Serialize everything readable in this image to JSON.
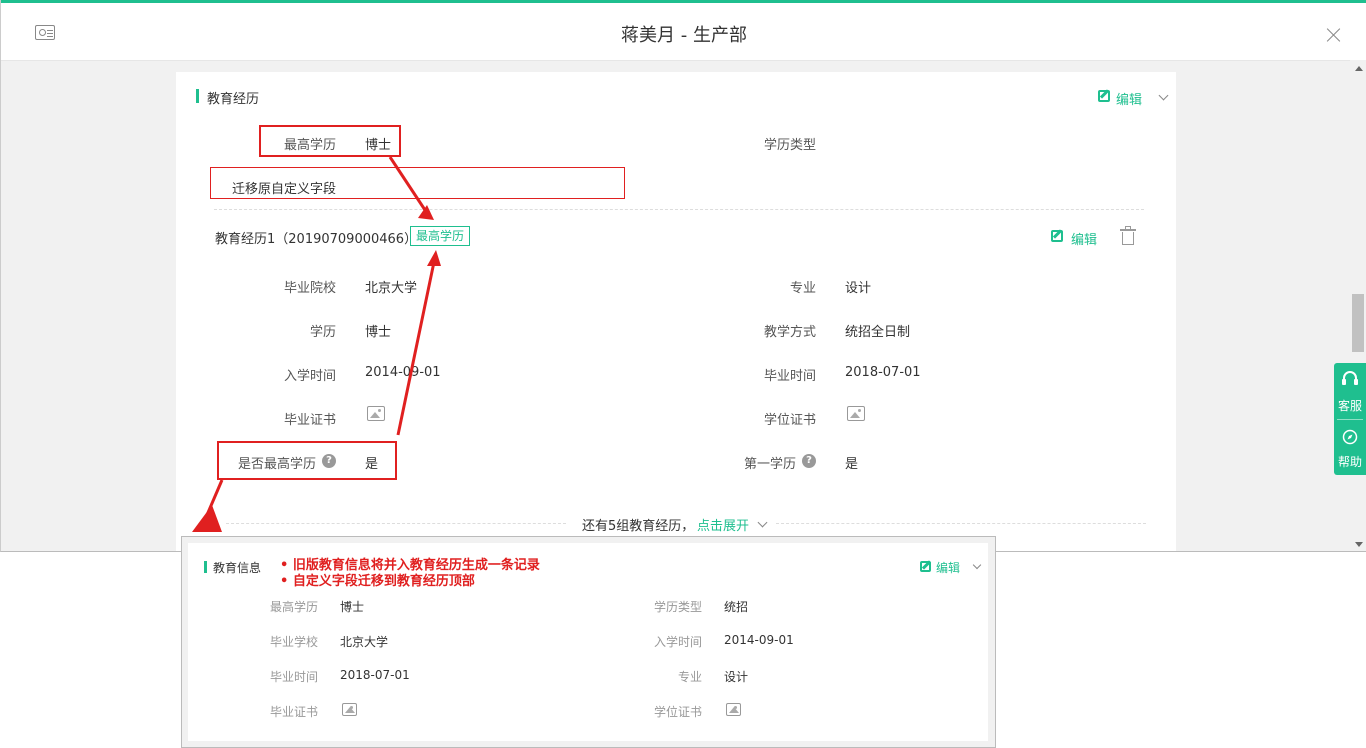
{
  "header": {
    "title": "蒋美月 - 生产部"
  },
  "education_section": {
    "title": "教育经历",
    "edit_label": "编辑",
    "top_fields": {
      "highest_degree_label": "最高学历",
      "highest_degree_value": "博士",
      "degree_type_label": "学历类型",
      "migrated_custom_field": "迁移原自定义字段"
    },
    "record": {
      "title": "教育经历1（20190709000466）",
      "tag": "最高学历",
      "edit_label": "编辑",
      "fields": {
        "school_label": "毕业院校",
        "school_value": "北京大学",
        "major_label": "专业",
        "major_value": "设计",
        "degree_label": "学历",
        "degree_value": "博士",
        "study_mode_label": "教学方式",
        "study_mode_value": "统招全日制",
        "enroll_label": "入学时间",
        "enroll_value": "2014-09-01",
        "grad_label": "毕业时间",
        "grad_value": "2018-07-01",
        "diploma_label": "毕业证书",
        "degree_cert_label": "学位证书",
        "is_highest_label": "是否最高学历",
        "is_highest_value": "是",
        "first_degree_label": "第一学历",
        "first_degree_value": "是"
      }
    },
    "more_text": "还有5组教育经历，",
    "expand_label": "点击展开"
  },
  "side_widget": {
    "service_label": "客服",
    "help_label": "帮助"
  },
  "old_panel": {
    "title": "教育信息",
    "edit_label": "编辑",
    "notes": [
      "旧版教育信息将并入教育经历生成一条记录",
      "自定义字段迁移到教育经历顶部"
    ],
    "fields": {
      "highest_label": "最高学历",
      "highest_value": "博士",
      "type_label": "学历类型",
      "type_value": "统招",
      "school_label": "毕业学校",
      "school_value": "北京大学",
      "enroll_label": "入学时间",
      "enroll_value": "2014-09-01",
      "grad_label": "毕业时间",
      "grad_value": "2018-07-01",
      "major_label": "专业",
      "major_value": "设计",
      "diploma_label": "毕业证书",
      "degree_cert_label": "学位证书"
    }
  },
  "colors": {
    "accent": "#1fbf8f",
    "annotation_red": "#e02020"
  }
}
